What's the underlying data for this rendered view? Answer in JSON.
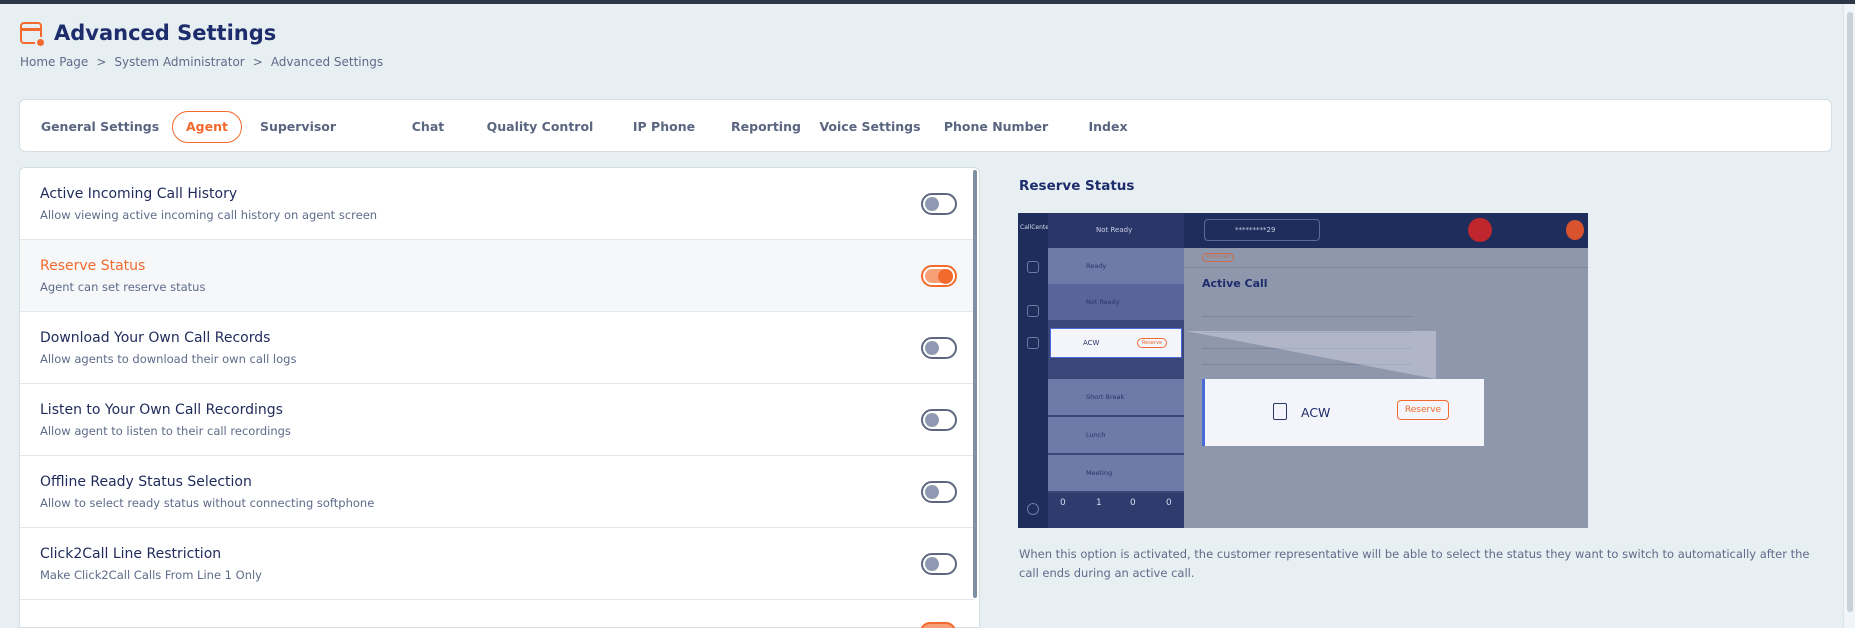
{
  "page": {
    "title": "Advanced Settings",
    "breadcrumb": [
      "Home Page",
      "System Administrator",
      "Advanced Settings"
    ],
    "breadcrumb_separator": ">"
  },
  "tabs": [
    {
      "label": "General Settings",
      "active": false
    },
    {
      "label": "Agent",
      "active": true
    },
    {
      "label": "Supervisor",
      "active": false
    },
    {
      "label": "Chat",
      "active": false
    },
    {
      "label": "Quality Control",
      "active": false
    },
    {
      "label": "IP Phone",
      "active": false
    },
    {
      "label": "Reporting",
      "active": false
    },
    {
      "label": "Voice Settings",
      "active": false
    },
    {
      "label": "Phone Number",
      "active": false
    },
    {
      "label": "Index",
      "active": false
    }
  ],
  "settings": [
    {
      "title": "Active Incoming Call History",
      "description": "Allow viewing active incoming call history on agent screen",
      "enabled": false
    },
    {
      "title": "Reserve Status",
      "description": "Agent can set reserve status",
      "enabled": true
    },
    {
      "title": "Download Your Own Call Records",
      "description": "Allow agents to download their own call logs",
      "enabled": false
    },
    {
      "title": "Listen to Your Own Call Recordings",
      "description": "Allow agent to listen to their call recordings",
      "enabled": false
    },
    {
      "title": "Offline Ready Status Selection",
      "description": "Allow to select ready status without connecting softphone",
      "enabled": false
    },
    {
      "title": "Click2Call Line Restriction",
      "description": "Make Click2Call Calls From Line 1 Only",
      "enabled": false
    }
  ],
  "preview": {
    "title": "Reserve Status",
    "description": "When this option is activated, the customer representative will be able to select the status they want to switch to automatically after the call ends during an active call.",
    "screenshot": {
      "status_select": "Not Ready",
      "phone_number": "*********29",
      "menu_items": [
        "Ready",
        "Not Ready",
        "ACW",
        "Short Break",
        "Lunch",
        "Meeting"
      ],
      "acw_label": "ACW",
      "reserve_label": "Reserve",
      "content_title": "Active Call",
      "active_tab": "Active Call",
      "stats": [
        "0",
        "1",
        "0",
        "0"
      ]
    }
  },
  "colors": {
    "accent": "#f26a2e",
    "navy": "#1d2c6b",
    "background": "#e8eff2"
  }
}
